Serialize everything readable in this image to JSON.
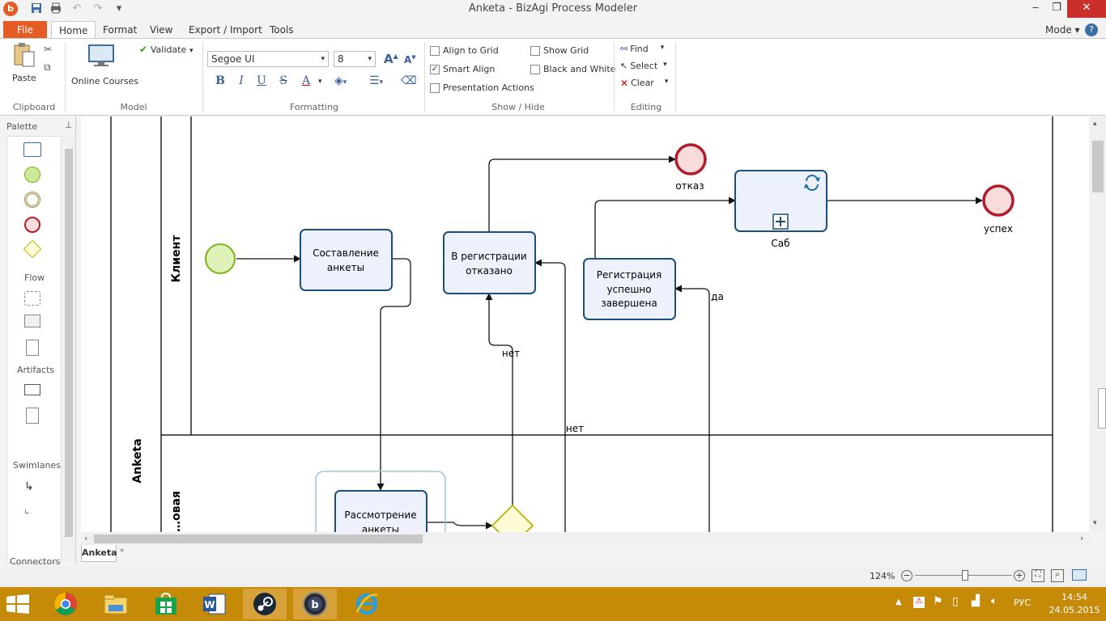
{
  "window": {
    "title": "Anketa - BizAgi Process Modeler",
    "minimize": "‒",
    "maximize": "❐",
    "close": "✕"
  },
  "quick_access": {
    "app_icon": "bizagi-logo-icon",
    "save": "save-icon",
    "print": "print-icon",
    "undo": "undo-icon",
    "redo": "redo-icon",
    "more": "▾"
  },
  "menu": {
    "tabs": [
      "File",
      "Home",
      "Format",
      "View",
      "Export / Import",
      "Tools"
    ],
    "mode_label": "Mode",
    "help_icon": "?"
  },
  "ribbon": {
    "clipboard": {
      "paste": "Paste",
      "group": "Clipboard"
    },
    "model": {
      "validate": "Validate",
      "online_courses": "Online Courses",
      "group": "Model"
    },
    "formatting": {
      "font": "Segoe UI",
      "size": "8",
      "group": "Formatting",
      "bold": "B",
      "italic": "I",
      "underline": "U",
      "strike": "S",
      "font_color": "A"
    },
    "show_hide": {
      "align_to_grid": "Align to Grid",
      "smart_align": "Smart Align",
      "presentation_actions": "Presentation Actions",
      "show_grid": "Show Grid",
      "black_and_white": "Black and White",
      "group": "Show / Hide",
      "checked": {
        "align_to_grid": false,
        "smart_align": true,
        "presentation_actions": false,
        "show_grid": false,
        "black_and_white": false
      }
    },
    "editing": {
      "find": "Find",
      "select": "Select",
      "clear": "Clear",
      "group": "Editing"
    }
  },
  "palette": {
    "title": "Palette",
    "pin": "⊥",
    "flow": "Flow",
    "artifacts": "Artifacts",
    "swimlanes": "Swimlanes",
    "connectors": "Connectors"
  },
  "diagram": {
    "pool_name": "Anketa",
    "lane_1": "Клиент",
    "lane_2": "…овая",
    "tasks": {
      "t1": [
        "Составление",
        "анкеты"
      ],
      "t2": [
        "В регистрации",
        "отказано"
      ],
      "t3": [
        "Регистрация",
        "успешно",
        "завершена"
      ],
      "t4": [
        "Рассмотрение",
        "анкеты"
      ],
      "sub": "Саб"
    },
    "events": {
      "refusal": "отказ",
      "success": "успех"
    },
    "flow_labels": {
      "no1": "нет",
      "no2": "нет",
      "yes": "да"
    },
    "colors": {
      "task_fill": "#edf1fb",
      "task_stroke": "#1f4e79",
      "start_fill": "#e0f2b8",
      "start_stroke": "#7db31c",
      "end_fill": "#f8dcdc",
      "end_stroke": "#b01c2c",
      "gateway_fill": "#fdfbd6",
      "gateway_stroke": "#c0b820"
    }
  },
  "doc_tabs": {
    "active": "Anketa",
    "new": "*"
  },
  "status": {
    "zoom": "124%",
    "minus": "−",
    "plus": "+"
  },
  "taskbar": {
    "apps": [
      "chrome-icon",
      "file-explorer-icon",
      "store-icon",
      "word-icon",
      "steam-icon",
      "bizagi-icon",
      "internet-explorer-icon"
    ],
    "lang": "РУС",
    "time": "14:54",
    "date": "24.05.2015"
  }
}
